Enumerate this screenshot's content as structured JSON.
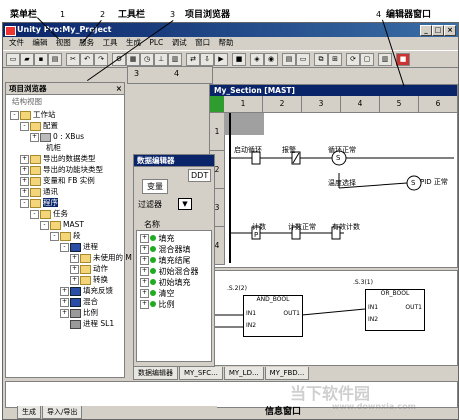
{
  "callouts": {
    "menubar": {
      "label": "菜单栏",
      "num": "1"
    },
    "toolbar": {
      "label": "工具栏",
      "num": "2"
    },
    "browser": {
      "label": "项目浏览器",
      "num": "3"
    },
    "editor": {
      "label": "编辑器窗口",
      "num": "4"
    },
    "info": {
      "label": "信息窗口"
    }
  },
  "window": {
    "title": "Unity Pro:My_Project"
  },
  "menu": [
    "文件",
    "编辑",
    "视图",
    "服务",
    "工具",
    "生成",
    "PLC",
    "调试",
    "窗口",
    "帮助"
  ],
  "project_browser": {
    "title": "项目浏览器",
    "subtitle": "结构视图",
    "items": [
      {
        "label": "工作站",
        "sel": false
      },
      {
        "label": "配置",
        "sel": false
      },
      {
        "label": "0 : XBus",
        "sel": false
      },
      {
        "label": "机柜",
        "sel": false
      },
      {
        "label": "导出的数据类型",
        "sel": false
      },
      {
        "label": "导出的功能块类型",
        "sel": false
      },
      {
        "label": "变量和 FB 实例",
        "sel": false
      },
      {
        "label": "通讯",
        "sel": false
      },
      {
        "label": "程序",
        "sel": true
      },
      {
        "label": "任务",
        "sel": false
      },
      {
        "label": "MAST",
        "sel": false
      },
      {
        "label": "段",
        "sel": false
      },
      {
        "label": "进程",
        "sel": false
      },
      {
        "label": "未使用的 M",
        "sel": false
      },
      {
        "label": "动作",
        "sel": false
      },
      {
        "label": "转换",
        "sel": false
      },
      {
        "label": "填充反馈",
        "sel": false
      },
      {
        "label": "混合",
        "sel": false
      },
      {
        "label": "比例",
        "sel": false
      },
      {
        "label": "进程 SL1",
        "sel": false
      }
    ],
    "tabs": [
      "生成",
      "导入/导出"
    ]
  },
  "data_editor": {
    "title": "数据编辑器",
    "tab": "变量",
    "filter_label": "过滤器",
    "ddt_label": "DDT",
    "name_col": "名称",
    "rows": [
      "填充",
      "混合器填",
      "填充结尾",
      "初始混合器",
      "初始填充",
      "清空",
      "比例"
    ]
  },
  "section": {
    "title": "My_Section [MAST]",
    "cols": [
      "1",
      "2",
      "3",
      "4",
      "5",
      "6"
    ],
    "rows": [
      "1",
      "2",
      "3",
      "4"
    ],
    "contacts": [
      {
        "label": "启动循环"
      },
      {
        "label": "报警"
      },
      {
        "label": "循环正常"
      },
      {
        "label": "温度选择"
      },
      {
        "label": "PID 正常"
      },
      {
        "label": "计数"
      },
      {
        "label": "计数正常"
      },
      {
        "label": "有效计数"
      }
    ],
    "coil_s": "S",
    "coil_p": "P",
    "fbd": {
      "and_label": "AND_BOOL",
      "or_label": "OR_BOOL",
      "s2": ".S.2(2)",
      "s3": ".S.3(1)",
      "in1": "IN1",
      "in2": "IN2",
      "out": "OUT1"
    }
  },
  "editor_tabs": [
    "数据编辑器",
    "MY_SFC...",
    "MY_LD...",
    "MY_FBD..."
  ],
  "left_col_headers": [
    "3",
    "4"
  ],
  "watermark": {
    "main": "当下软件园",
    "sub": "www.downxia.com"
  }
}
